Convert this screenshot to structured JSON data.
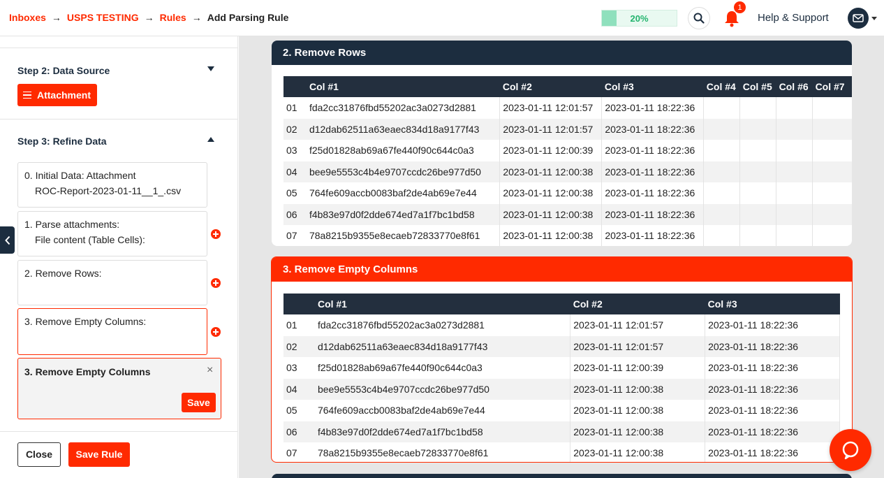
{
  "breadcrumb": {
    "items": [
      "Inboxes",
      "USPS TESTING",
      "Rules"
    ],
    "current": "Add Parsing Rule",
    "separator": "→"
  },
  "progress": {
    "label": "20%",
    "value": 0.2
  },
  "notifications": {
    "count": "1"
  },
  "help": {
    "label": "Help & Support"
  },
  "icons": {
    "search": "search-icon",
    "bell": "bell-icon",
    "avatar": "mail-icon",
    "collapse": "chevron-left-icon",
    "chat": "chat-icon"
  },
  "colors": {
    "accent": "#ff2a00",
    "dark": "#1c2d3f",
    "success": "#23b46e"
  },
  "sidebar": {
    "step2": {
      "title": "Step 2: Data Source",
      "button": "Attachment"
    },
    "step3": {
      "title": "Step 3: Refine Data"
    },
    "cards": [
      {
        "line1": "0. Initial Data: Attachment",
        "line2": "ROC-Report-2023-01-11__1_.csv"
      },
      {
        "line1": "1. Parse attachments:",
        "line2": "File content (Table Cells):"
      },
      {
        "line1": "2. Remove Rows:",
        "line2": ""
      },
      {
        "line1": "3. Remove Empty Columns:",
        "line2": ""
      }
    ],
    "edit": {
      "title": "3. Remove Empty Columns",
      "close": "×",
      "save": "Save"
    },
    "close_label": "Close",
    "save_rule_label": "Save Rule"
  },
  "panels": [
    {
      "title": "2. Remove Rows",
      "columns": [
        "",
        "Col #1",
        "Col #2",
        "Col #3",
        "Col #4",
        "Col #5",
        "Col #6",
        "Col #7"
      ],
      "rows": [
        [
          "01",
          "fda2cc31876fbd55202ac3a0273d2881",
          "2023-01-11 12:01:57",
          "2023-01-11 18:22:36",
          "",
          "",
          "",
          ""
        ],
        [
          "02",
          "d12dab62511a63eaec834d18a9177f43",
          "2023-01-11 12:01:57",
          "2023-01-11 18:22:36",
          "",
          "",
          "",
          ""
        ],
        [
          "03",
          "f25d01828ab69a67fe440f90c644c0a3",
          "2023-01-11 12:00:39",
          "2023-01-11 18:22:36",
          "",
          "",
          "",
          ""
        ],
        [
          "04",
          "bee9e5553c4b4e9707ccdc26be977d50",
          "2023-01-11 12:00:38",
          "2023-01-11 18:22:36",
          "",
          "",
          "",
          ""
        ],
        [
          "05",
          "764fe609accb0083baf2de4ab69e7e44",
          "2023-01-11 12:00:38",
          "2023-01-11 18:22:36",
          "",
          "",
          "",
          ""
        ],
        [
          "06",
          "f4b83e97d0f2dde674ed7a1f7bc1bd58",
          "2023-01-11 12:00:38",
          "2023-01-11 18:22:36",
          "",
          "",
          "",
          ""
        ],
        [
          "07",
          "78a8215b9355e8ecaeb72833770e8f61",
          "2023-01-11 12:00:38",
          "2023-01-11 18:22:36",
          "",
          "",
          "",
          ""
        ]
      ]
    },
    {
      "title": "3. Remove Empty Columns",
      "columns": [
        "",
        "Col #1",
        "Col #2",
        "Col #3"
      ],
      "rows": [
        [
          "01",
          "fda2cc31876fbd55202ac3a0273d2881",
          "2023-01-11 12:01:57",
          "2023-01-11 18:22:36"
        ],
        [
          "02",
          "d12dab62511a63eaec834d18a9177f43",
          "2023-01-11 12:01:57",
          "2023-01-11 18:22:36"
        ],
        [
          "03",
          "f25d01828ab69a67fe440f90c644c0a3",
          "2023-01-11 12:00:39",
          "2023-01-11 18:22:36"
        ],
        [
          "04",
          "bee9e5553c4b4e9707ccdc26be977d50",
          "2023-01-11 12:00:38",
          "2023-01-11 18:22:36"
        ],
        [
          "05",
          "764fe609accb0083baf2de4ab69e7e44",
          "2023-01-11 12:00:38",
          "2023-01-11 18:22:36"
        ],
        [
          "06",
          "f4b83e97d0f2dde674ed7a1f7bc1bd58",
          "2023-01-11 12:00:38",
          "2023-01-11 18:22:36"
        ],
        [
          "07",
          "78a8215b9355e8ecaeb72833770e8f61",
          "2023-01-11 12:00:38",
          "2023-01-11 18:22:36"
        ]
      ]
    }
  ]
}
